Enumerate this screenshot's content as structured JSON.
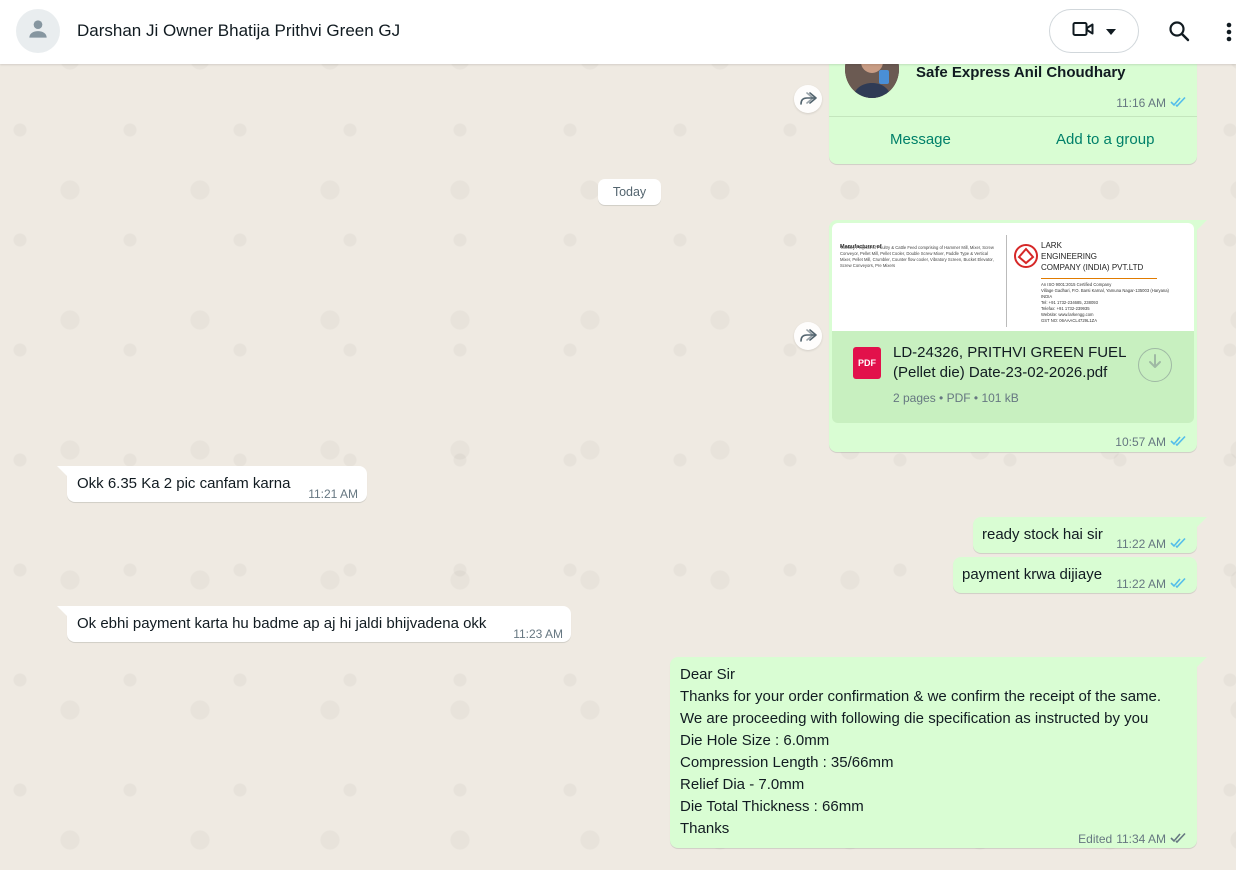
{
  "header": {
    "contact_name": "Darshan Ji Owner Bhatija Prithvi Green GJ"
  },
  "contact_card": {
    "name": "Safe Express Anil Choudhary",
    "time": "11:16 AM",
    "message_label": "Message",
    "add_group_label": "Add to a group"
  },
  "date_divider": "Today",
  "document": {
    "preview": {
      "manufacturer_heading": "Manufacturer of",
      "manufacturer_text": "Turnkey Projects of Poultry & Cattle Feed comprising of Hammer Mill, Mixer, Screw Conveyor, Pellet Mill, Pellet Cooler, Double Screw Mixer, Paddle Type & Vertical Mixer, Pellet Mill, Crumbler, Counter flow cooler, Vibratory Screen, Bucket Elevator, Screw Conveyors, Pre Mixers",
      "company_line1": "LARK",
      "company_line2": "ENGINEERING",
      "company_line3": "COMPANY (INDIA) PVT.LTD",
      "iso_line": "An ISO 9001:2015 Certified Company",
      "address_text": "Village Gadhari, P.O. Barsi Karnal, Yamuna Nagar-135003 (Haryana) INDIA",
      "tel_text": "Tel: +91 1732-234685, 238093",
      "fax_text": "Telefax: +91 1732-239935",
      "web_text": "Website: www.larkengg.com",
      "gst_text": "GST NO: 06AAACL4729L1ZA"
    },
    "pdf_badge": "PDF",
    "file_name": "LD-24326, PRITHVI GREEN FUEL (Pellet die) Date-23-02-2026.pdf",
    "file_meta": "2 pages • PDF • 101 kB",
    "time": "10:57 AM"
  },
  "messages": [
    {
      "text": "Okk 6.35 Ka 2 pic canfam karna",
      "time": "11:21 AM"
    },
    {
      "text": "ready stock hai sir",
      "time": "11:22 AM"
    },
    {
      "text": "payment krwa dijiaye",
      "time": "11:22 AM"
    },
    {
      "text": "Ok ebhi payment karta hu badme ap aj hi jaldi bhijvadena okk",
      "time": "11:23 AM"
    }
  ],
  "final_message": {
    "lines": [
      "Dear Sir",
      "Thanks for your order confirmation & we confirm the receipt of the same.",
      "We are proceeding with following die specification as instructed by you",
      "Die Hole Size : 6.0mm",
      "Compression Length : 35/66mm",
      "Relief Dia - 7.0mm",
      "Die Total Thickness : 66mm",
      "Thanks"
    ],
    "edited_label": "Edited",
    "time": "11:34 AM"
  },
  "colors": {
    "outgoing_bubble": "#d9fdd3",
    "incoming_bubble": "#ffffff",
    "read_ticks": "#53bdeb",
    "action_green": "#008069"
  }
}
